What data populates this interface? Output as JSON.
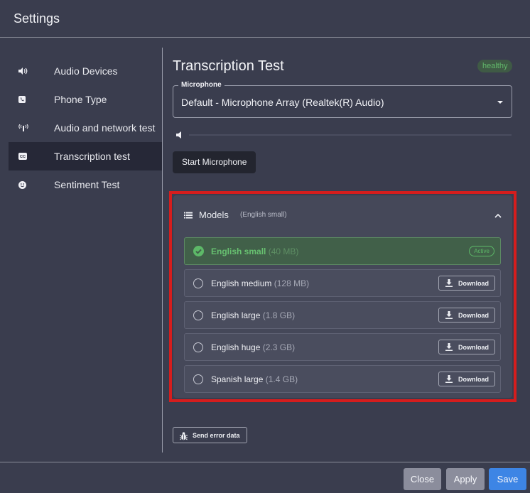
{
  "window": {
    "title": "Settings"
  },
  "sidebar": {
    "items": [
      {
        "label": "Audio Devices",
        "icon": "volume-icon"
      },
      {
        "label": "Phone Type",
        "icon": "phone-icon"
      },
      {
        "label": "Audio and network test",
        "icon": "signal-icon"
      },
      {
        "label": "Transcription test",
        "icon": "closed-caption-icon",
        "active": true
      },
      {
        "label": "Sentiment Test",
        "icon": "smiley-icon"
      }
    ]
  },
  "main": {
    "title": "Transcription Test",
    "status_badge": "healthy",
    "microphone": {
      "label": "Microphone",
      "value": "Default - Microphone Array (Realtek(R) Audio)"
    },
    "mic_level": 0,
    "start_button": "Start Microphone",
    "models": {
      "title": "Models",
      "subtitle": "(English small)",
      "items": [
        {
          "name": "English small",
          "size": "(40 MB)",
          "status": "Active",
          "active": true
        },
        {
          "name": "English medium",
          "size": "(128 MB)",
          "action": "Download"
        },
        {
          "name": "English large",
          "size": "(1.8 GB)",
          "action": "Download"
        },
        {
          "name": "English huge",
          "size": "(2.3 GB)",
          "action": "Download"
        },
        {
          "name": "Spanish large",
          "size": "(1.4 GB)",
          "action": "Download"
        }
      ]
    },
    "send_error_button": "Send error data"
  },
  "footer": {
    "close": "Close",
    "apply": "Apply",
    "save": "Save"
  },
  "colors": {
    "background": "#3a3d4e",
    "highlight_box": "#d51d1d",
    "active_green": "#5db968",
    "save_blue": "#3d85e5"
  }
}
